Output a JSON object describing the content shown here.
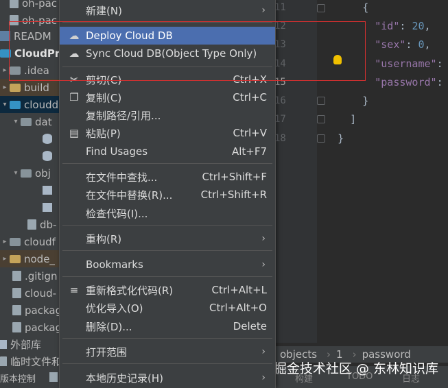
{
  "tree": {
    "rows": [
      {
        "label": "oh-pac",
        "icon": "file-icon"
      },
      {
        "label": "oh-pac",
        "icon": "file-icon"
      },
      {
        "label": "READM",
        "icon": "markdown-icon"
      },
      {
        "label": "CloudPro",
        "icon": "project-icon"
      },
      {
        "label": ".idea",
        "icon": "folder-icon"
      },
      {
        "label": "build",
        "icon": "folder-icon"
      },
      {
        "label": "cloudd",
        "icon": "folder-icon"
      },
      {
        "label": "dat",
        "icon": "folder-icon"
      },
      {
        "label": "",
        "icon": "database-icon"
      },
      {
        "label": "",
        "icon": "database-icon"
      },
      {
        "label": "obj",
        "icon": "folder-icon"
      },
      {
        "label": "",
        "icon": "table-icon"
      },
      {
        "label": "",
        "icon": "table-icon"
      },
      {
        "label": "db-",
        "icon": "file-icon"
      },
      {
        "label": "cloudf",
        "icon": "folder-icon"
      },
      {
        "label": "node_",
        "icon": "folder-icon"
      },
      {
        "label": ".gitign",
        "icon": "file-icon"
      },
      {
        "label": "cloud-",
        "icon": "file-icon"
      },
      {
        "label": "packag",
        "icon": "file-icon"
      },
      {
        "label": "packag",
        "icon": "file-icon"
      },
      {
        "label": "外部库",
        "icon": "library-icon"
      },
      {
        "label": "临时文件和",
        "icon": "file-icon"
      }
    ]
  },
  "menu": {
    "new": "新建(N)",
    "deploy_cloud_db": "Deploy Cloud DB",
    "sync_cloud_db": "Sync Cloud DB(Object Type Only)",
    "cut": "剪切(C)",
    "cut_shortcut": "Ctrl+X",
    "copy": "复制(C)",
    "copy_shortcut": "Ctrl+C",
    "copy_path": "复制路径/引用...",
    "paste": "粘贴(P)",
    "paste_shortcut": "Ctrl+V",
    "find_usages": "Find Usages",
    "find_usages_shortcut": "Alt+F7",
    "find_in_files": "在文件中查找...",
    "find_in_files_shortcut": "Ctrl+Shift+F",
    "replace_in_files": "在文件中替换(R)...",
    "replace_in_files_shortcut": "Ctrl+Shift+R",
    "inspect_code": "检查代码(I)...",
    "refactor": "重构(R)",
    "bookmarks": "Bookmarks",
    "reformat_code": "重新格式化代码(R)",
    "reformat_code_shortcut": "Ctrl+Alt+L",
    "optimize_imports": "优化导入(O)",
    "optimize_imports_shortcut": "Ctrl+Alt+O",
    "delete": "删除(D)...",
    "delete_shortcut": "Delete",
    "open_in": "打开范围",
    "local_history": "本地历史记录(H)",
    "submenu_arrow": "›"
  },
  "editor": {
    "line_numbers": [
      "11",
      "12",
      "13",
      "14",
      "15",
      "16",
      "17",
      "18"
    ],
    "lines": [
      {
        "indent": "      ",
        "text": "{"
      },
      {
        "indent": "        ",
        "key": "\"id\"",
        "sep": ": ",
        "value": "20",
        "kind": "num",
        "tail": ","
      },
      {
        "indent": "        ",
        "key": "\"sex\"",
        "sep": ": ",
        "value": "0",
        "kind": "num",
        "tail": ","
      },
      {
        "indent": "        ",
        "key": "\"username\"",
        "sep": ":",
        "value": "",
        "kind": "str",
        "tail": ""
      },
      {
        "indent": "        ",
        "key": "\"password\"",
        "sep": ":",
        "value": "",
        "kind": "str",
        "tail": ""
      },
      {
        "indent": "      ",
        "text": "}"
      },
      {
        "indent": "    ",
        "text": "]"
      },
      {
        "indent": "  ",
        "text": "}"
      }
    ]
  },
  "breadcrumb": {
    "items": [
      "objects",
      "1",
      "password"
    ],
    "separator": "›"
  },
  "statusbar": {
    "version_control": "版本控制",
    "build": "构建",
    "todo": "TODO",
    "log": "日志"
  },
  "watermark": "掘金技术社区 @ 东林知识库",
  "colors": {
    "menu_bg": "#3c3f41",
    "menu_highlight": "#4b6eaf",
    "editor_bg": "#2b2b2b",
    "json_key": "#9876aa",
    "json_number": "#6897bb",
    "highlight_box": "#d63030"
  }
}
